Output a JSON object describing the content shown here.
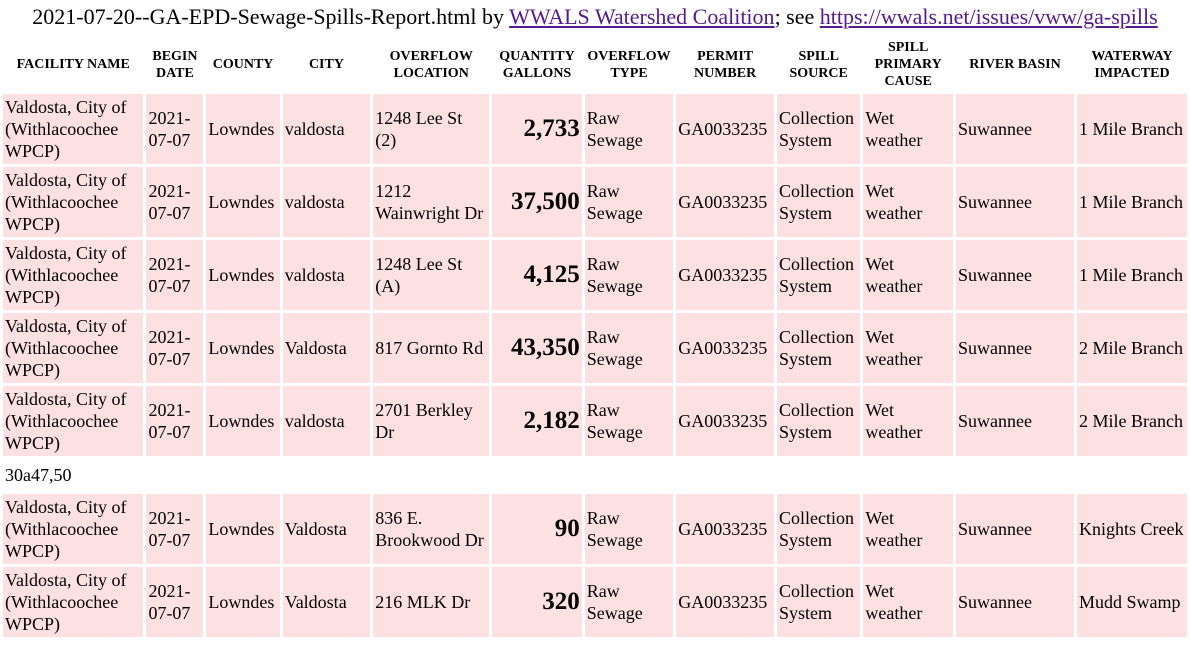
{
  "header": {
    "filename": "2021-07-20--GA-EPD-Sewage-Spills-Report.html",
    "by_text": " by ",
    "org_link": "WWALS Watershed Coalition",
    "see_text": "; see ",
    "issue_link": "https://wwals.net/issues/vww/ga-spills",
    "link_color": "#0000ee",
    "visited_link_color": "#551a8b"
  },
  "table": {
    "cell_background": "#fde1e2",
    "columns": [
      "FACILITY NAME",
      "BEGIN DATE",
      "COUNTY",
      "CITY",
      "OVERFLOW LOCATION",
      "QUANTITY GALLONS",
      "OVERFLOW TYPE",
      "PERMIT NUMBER",
      "SPILL SOURCE",
      "SPILL PRIMARY CAUSE",
      "RIVER BASIN",
      "WATERWAY IMPACTED"
    ],
    "rows": [
      {
        "facility": "Valdosta, City of (Withlacoochee WPCP)",
        "date": "2021-07-07",
        "county": "Lowndes",
        "city": "valdosta",
        "location": "1248 Lee St (2)",
        "quantity": "2,733",
        "type": "Raw Sewage",
        "permit": "GA0033235",
        "source": "Collection System",
        "cause": "Wet weather",
        "basin": "Suwannee",
        "waterway": "1 Mile Branch"
      },
      {
        "facility": "Valdosta, City of (Withlacoochee WPCP)",
        "date": "2021-07-07",
        "county": "Lowndes",
        "city": "valdosta",
        "location": "1212 Wainwright Dr",
        "quantity": "37,500",
        "type": "Raw Sewage",
        "permit": "GA0033235",
        "source": "Collection System",
        "cause": "Wet weather",
        "basin": "Suwannee",
        "waterway": "1 Mile Branch"
      },
      {
        "facility": "Valdosta, City of (Withlacoochee WPCP)",
        "date": "2021-07-07",
        "county": "Lowndes",
        "city": "valdosta",
        "location": "1248 Lee St (A)",
        "quantity": "4,125",
        "type": "Raw Sewage",
        "permit": "GA0033235",
        "source": "Collection System",
        "cause": "Wet weather",
        "basin": "Suwannee",
        "waterway": "1 Mile Branch"
      },
      {
        "facility": "Valdosta, City of (Withlacoochee WPCP)",
        "date": "2021-07-07",
        "county": "Lowndes",
        "city": "Valdosta",
        "location": "817 Gornto Rd",
        "quantity": "43,350",
        "type": "Raw Sewage",
        "permit": "GA0033235",
        "source": "Collection System",
        "cause": "Wet weather",
        "basin": "Suwannee",
        "waterway": "2 Mile Branch"
      },
      {
        "facility": "Valdosta, City of (Withlacoochee WPCP)",
        "date": "2021-07-07",
        "county": "Lowndes",
        "city": "valdosta",
        "location": "2701 Berkley Dr",
        "quantity": "2,182",
        "type": "Raw Sewage",
        "permit": "GA0033235",
        "source": "Collection System",
        "cause": "Wet weather",
        "basin": "Suwannee",
        "waterway": "2 Mile Branch"
      }
    ],
    "note": "30a47,50",
    "rows_after_note": [
      {
        "facility": "Valdosta, City of (Withlacoochee WPCP)",
        "date": "2021-07-07",
        "county": "Lowndes",
        "city": "Valdosta",
        "location": "836 E. Brookwood Dr",
        "quantity": "90",
        "type": "Raw Sewage",
        "permit": "GA0033235",
        "source": "Collection System",
        "cause": "Wet weather",
        "basin": "Suwannee",
        "waterway": "Knights Creek"
      },
      {
        "facility": "Valdosta, City of (Withlacoochee WPCP)",
        "date": "2021-07-07",
        "county": "Lowndes",
        "city": "Valdosta",
        "location": "216 MLK Dr",
        "quantity": "320",
        "type": "Raw Sewage",
        "permit": "GA0033235",
        "source": "Collection System",
        "cause": "Wet weather",
        "basin": "Suwannee",
        "waterway": "Mudd Swamp"
      }
    ]
  }
}
